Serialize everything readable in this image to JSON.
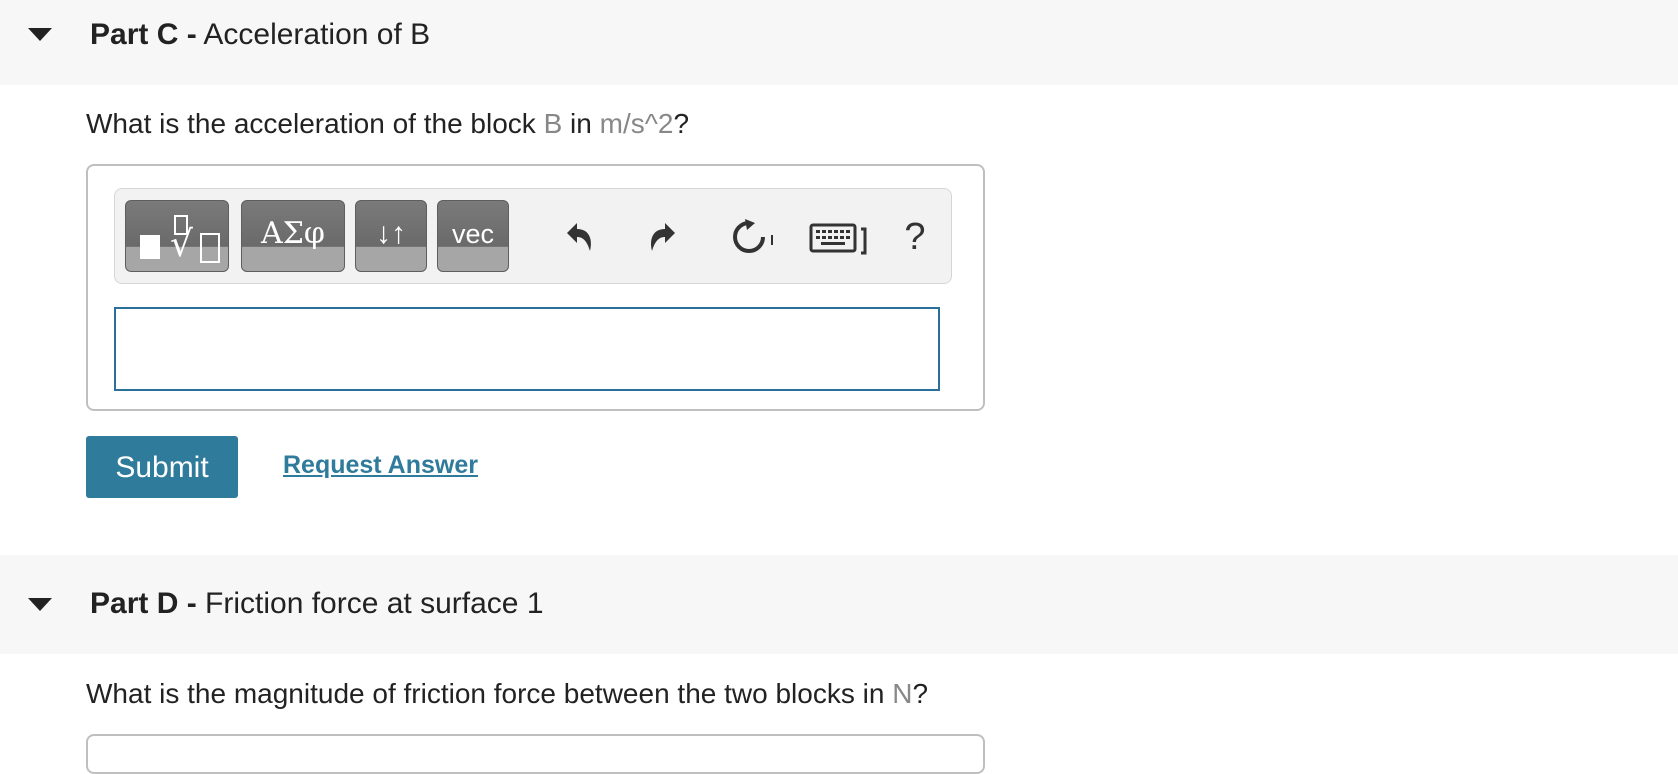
{
  "partC": {
    "label": "Part C -",
    "title": "Acceleration of B",
    "question_prefix": "What is the acceleration of the block ",
    "var": "B",
    "question_mid": " in ",
    "unit": "m/s^2",
    "question_suffix": "?"
  },
  "toolbar": {
    "greek_label": "ΑΣφ",
    "arrows_label": "↓↑",
    "vec_label": "vec",
    "help_label": "?"
  },
  "actions": {
    "submit_label": "Submit",
    "request_label": "Request Answer"
  },
  "partD": {
    "label": "Part D -",
    "title": "Friction force at surface 1",
    "question_prefix": "What is the magnitude of friction force between the two blocks in ",
    "unit": "N",
    "question_suffix": "?"
  },
  "colors": {
    "accent": "#2f7b9b",
    "input_border": "#2b6f9b",
    "header_bg": "#f7f7f7"
  },
  "icons": {
    "undo": "undo-icon",
    "redo": "redo-icon",
    "reset": "reset-icon",
    "keyboard": "keyboard-icon",
    "help": "help-icon"
  }
}
